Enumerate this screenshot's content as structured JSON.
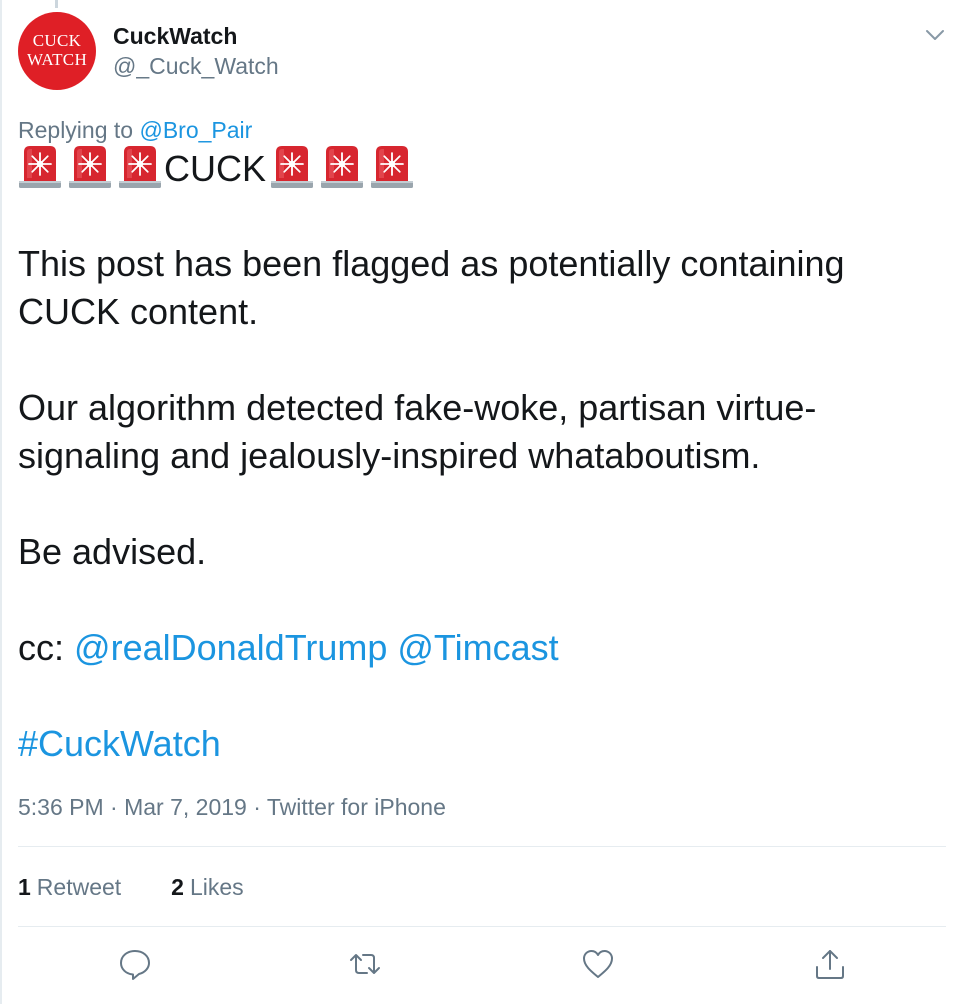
{
  "user": {
    "display_name": "CuckWatch",
    "handle": "@_Cuck_Watch",
    "avatar_line1": "CUCK",
    "avatar_line2": "WATCH",
    "avatar_color": "#df1f26"
  },
  "reply": {
    "prefix": "Replying to",
    "mention": "@Bro_Pair"
  },
  "tweet": {
    "siren_icon": "police-car-light-emoji",
    "sirens_before": 3,
    "sirens_after": 3,
    "headline": "CUCK",
    "para1_line1": "This post has been flagged as potentially containing",
    "para1_line2": "CUCK content.",
    "para2_line1": "Our algorithm detected fake-woke, partisan virtue-",
    "para2_line2": "signaling and jealously-inspired whataboutism.",
    "para3": "Be advised.",
    "cc_prefix": "cc:",
    "cc_mention1": "@realDonaldTrump",
    "cc_mention2": "@Timcast",
    "hashtag": "#CuckWatch"
  },
  "meta": {
    "time": "5:36 PM",
    "date": "Mar 7, 2019",
    "source": "Twitter for iPhone",
    "separator": "·"
  },
  "stats": {
    "retweet_count": "1",
    "retweet_label": "Retweet",
    "like_count": "2",
    "like_label": "Likes"
  },
  "actions": [
    "reply-icon",
    "retweet-icon",
    "like-icon",
    "share-icon"
  ],
  "colors": {
    "link": "#1b95e0",
    "muted": "#657786",
    "text": "#14171a",
    "divider": "#e6ecf0"
  }
}
